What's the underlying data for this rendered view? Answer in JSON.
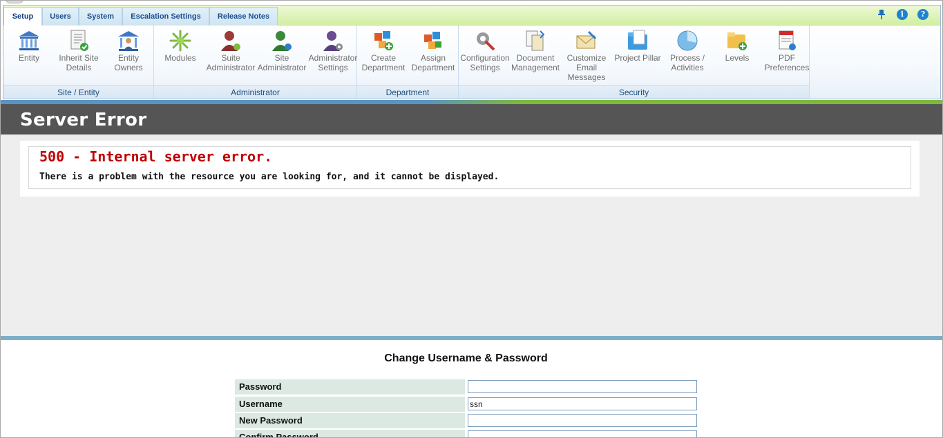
{
  "tabs": [
    "Setup",
    "Users",
    "System",
    "Escalation Settings",
    "Release Notes"
  ],
  "top_icons": [
    "pin-icon",
    "info-icon",
    "help-icon"
  ],
  "groups": [
    {
      "label": "Site / Entity",
      "buttons": [
        {
          "label": "Entity",
          "icon": "bank-icon"
        },
        {
          "label": "Inherit Site Details",
          "icon": "document-check-icon"
        },
        {
          "label": "Entity Owners",
          "icon": "bank-user-icon"
        }
      ]
    },
    {
      "label": "Administrator",
      "buttons": [
        {
          "label": "Modules",
          "icon": "modules-icon"
        },
        {
          "label": "Suite Administrator",
          "icon": "user-red-icon"
        },
        {
          "label": "Site Administrator",
          "icon": "user-green-icon"
        },
        {
          "label": "Administrator Settings",
          "icon": "user-gear-icon"
        }
      ]
    },
    {
      "label": "Department",
      "buttons": [
        {
          "label": "Create Department",
          "icon": "cubes-add-icon"
        },
        {
          "label": "Assign Department",
          "icon": "cubes-assign-icon"
        }
      ]
    },
    {
      "label": "Security",
      "buttons": [
        {
          "label": "Configuration Settings",
          "icon": "tools-icon"
        },
        {
          "label": "Document Management",
          "icon": "documents-icon"
        },
        {
          "label": "Customize Email Messages",
          "icon": "email-edit-icon"
        },
        {
          "label": "Project Pillar",
          "icon": "folder-blue-icon"
        },
        {
          "label": "Process / Activities",
          "icon": "pie-icon"
        },
        {
          "label": "Levels",
          "icon": "folder-add-icon"
        },
        {
          "label": "PDF Preferences",
          "icon": "pdf-icon"
        }
      ]
    }
  ],
  "page": {
    "title": "Server Error",
    "error_title": "500 - Internal server error.",
    "error_message": "There is a problem with the resource you are looking for, and it cannot be displayed."
  },
  "form": {
    "title": "Change Username & Password",
    "fields": [
      {
        "label": "Password",
        "value": ""
      },
      {
        "label": "Username",
        "value": "ssn"
      },
      {
        "label": "New Password",
        "value": ""
      },
      {
        "label": "Confirm Password",
        "value": ""
      }
    ]
  },
  "colors": {
    "error_red": "#c00000",
    "title_bar": "#555555",
    "ribbon_green": "#d2efa2",
    "link_blue": "#1c4c8c"
  }
}
